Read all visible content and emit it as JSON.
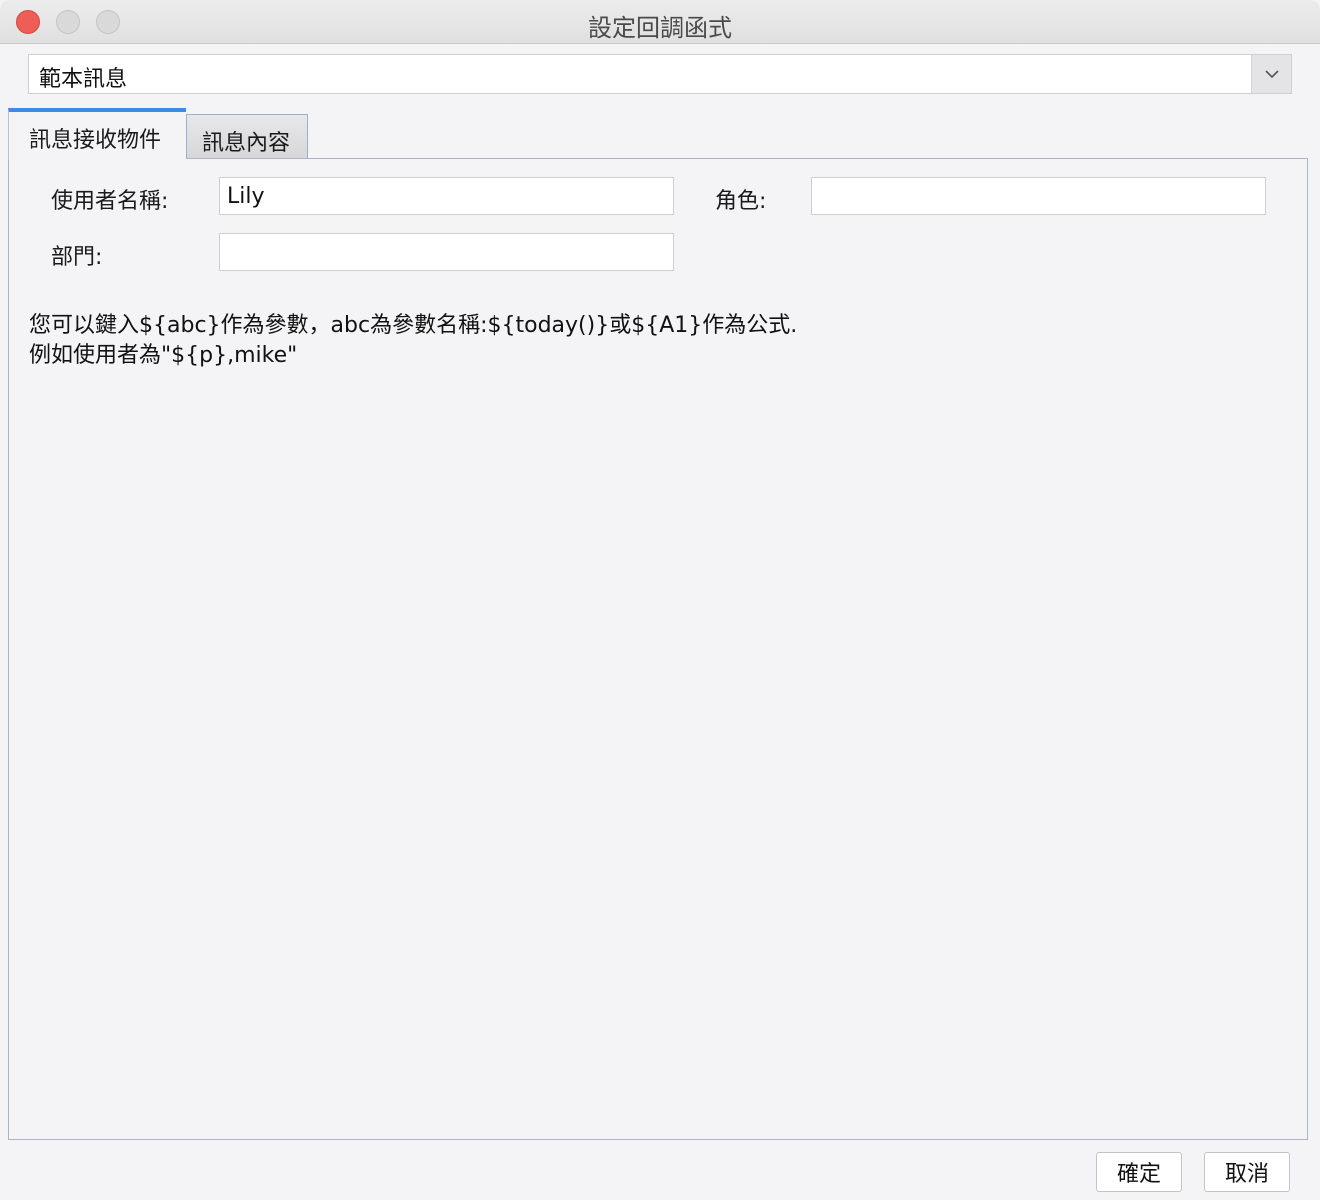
{
  "window": {
    "title": "設定回調函式"
  },
  "template_select": {
    "value": "範本訊息"
  },
  "tabs": [
    {
      "label": "訊息接收物件",
      "active": true
    },
    {
      "label": "訊息內容",
      "active": false
    }
  ],
  "recipient": {
    "username_label": "使用者名稱:",
    "username_value": "Lily",
    "role_label": "角色:",
    "role_value": "",
    "department_label": "部門:",
    "department_value": ""
  },
  "hint": {
    "line1": "您可以鍵入${abc}作為參數，abc為參數名稱:${today()}或${A1}作為公式.",
    "line2": "例如使用者為\"${p},mike\""
  },
  "buttons": {
    "ok": "確定",
    "cancel": "取消"
  },
  "colors": {
    "accent": "#3c8ce6",
    "close_button": "#ee5e56"
  }
}
